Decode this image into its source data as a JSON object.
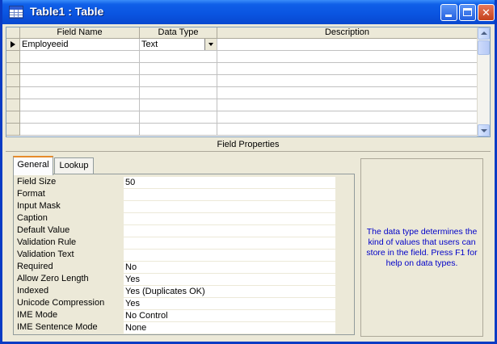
{
  "window": {
    "title": "Table1 : Table"
  },
  "grid": {
    "columns": [
      "Field Name",
      "Data Type",
      "Description"
    ],
    "rows": [
      {
        "field_name": "Employeeid",
        "data_type": "Text",
        "description": ""
      }
    ]
  },
  "field_properties": {
    "label": "Field Properties",
    "tabs": [
      "General",
      "Lookup"
    ],
    "active_tab": "General",
    "properties": [
      {
        "label": "Field Size",
        "value": "50"
      },
      {
        "label": "Format",
        "value": ""
      },
      {
        "label": "Input Mask",
        "value": ""
      },
      {
        "label": "Caption",
        "value": ""
      },
      {
        "label": "Default Value",
        "value": ""
      },
      {
        "label": "Validation Rule",
        "value": ""
      },
      {
        "label": "Validation Text",
        "value": ""
      },
      {
        "label": "Required",
        "value": "No"
      },
      {
        "label": "Allow Zero Length",
        "value": "Yes"
      },
      {
        "label": "Indexed",
        "value": "Yes (Duplicates OK)"
      },
      {
        "label": "Unicode Compression",
        "value": "Yes"
      },
      {
        "label": "IME Mode",
        "value": "No Control"
      },
      {
        "label": "IME Sentence Mode",
        "value": "None"
      }
    ],
    "help_text": "The data type determines the kind of values that users can store in the field.  Press F1 for help on data types."
  },
  "icons": [
    "table-icon",
    "minimize-icon",
    "maximize-icon",
    "close-icon",
    "row-pointer-icon",
    "dropdown-arrow-icon",
    "scroll-up-icon",
    "scroll-down-icon"
  ],
  "colors": {
    "titlebar": "#0A54E0",
    "window_bg": "#ECE9D8",
    "help_text": "#0000C8",
    "active_tab_accent": "#E68B2C"
  }
}
